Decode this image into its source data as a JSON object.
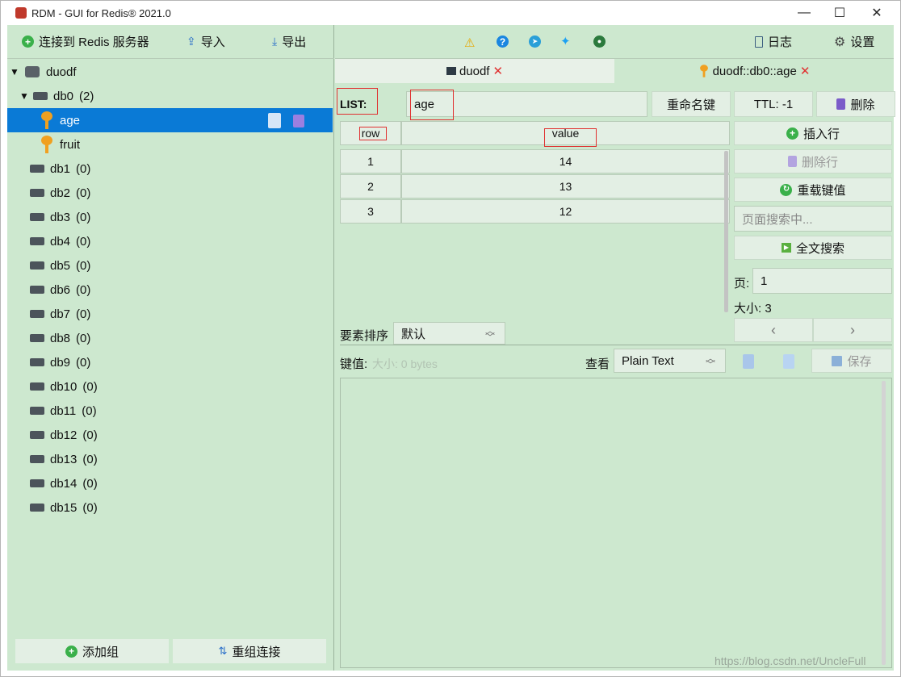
{
  "window": {
    "title": "RDM - GUI for Redis® 2021.0",
    "controls": {
      "minimize": "—",
      "maximize": "☐",
      "close": "✕"
    }
  },
  "left_toolbar": {
    "connect_label": "连接到 Redis 服务器",
    "import_label": "导入",
    "export_label": "导出"
  },
  "tree": {
    "server": "duodf",
    "databases": [
      {
        "name": "db0",
        "count": "(2)",
        "expanded": true
      },
      {
        "name": "db1",
        "count": "(0)"
      },
      {
        "name": "db2",
        "count": "(0)"
      },
      {
        "name": "db3",
        "count": "(0)"
      },
      {
        "name": "db4",
        "count": "(0)"
      },
      {
        "name": "db5",
        "count": "(0)"
      },
      {
        "name": "db6",
        "count": "(0)"
      },
      {
        "name": "db7",
        "count": "(0)"
      },
      {
        "name": "db8",
        "count": "(0)"
      },
      {
        "name": "db9",
        "count": "(0)"
      },
      {
        "name": "db10",
        "count": "(0)"
      },
      {
        "name": "db11",
        "count": "(0)"
      },
      {
        "name": "db12",
        "count": "(0)"
      },
      {
        "name": "db13",
        "count": "(0)"
      },
      {
        "name": "db14",
        "count": "(0)"
      },
      {
        "name": "db15",
        "count": "(0)"
      }
    ],
    "keys": [
      {
        "name": "age",
        "selected": true
      },
      {
        "name": "fruit",
        "selected": false
      }
    ]
  },
  "left_bottom": {
    "add_group_label": "添加组",
    "regroup_label": "重组连接"
  },
  "right_toolbar": {
    "log_label": "日志",
    "settings_label": "设置"
  },
  "tabs": [
    {
      "label": "duodf",
      "close": "✕"
    },
    {
      "label": "duodf::db0::age",
      "close": "✕"
    }
  ],
  "key_view": {
    "type_label": "LIST:",
    "key_name": "age",
    "rename_label": "重命名键",
    "ttl_label": "TTL:  -1",
    "delete_label": "删除",
    "columns": {
      "row": "row",
      "value": "value"
    },
    "rows": [
      {
        "row": "1",
        "value": "14"
      },
      {
        "row": "2",
        "value": "13"
      },
      {
        "row": "3",
        "value": "12"
      }
    ],
    "insert_row_label": "插入行",
    "delete_row_label": "删除行",
    "reload_label": "重载键值",
    "page_search_placeholder": "页面搜索中...",
    "fulltext_search_label": "全文搜索",
    "page_label": "页:",
    "page_value": "1",
    "size_label": "大小: 3",
    "prev": "‹",
    "next": "›",
    "sort_label": "要素排序",
    "sort_value": "默认"
  },
  "value_editor": {
    "value_label": "键值:",
    "size_hint": "大小: 0 bytes",
    "view_label": "查看",
    "format_value": "Plain Text",
    "save_label": "保存"
  },
  "watermark": "https://blog.csdn.net/UncleFull"
}
